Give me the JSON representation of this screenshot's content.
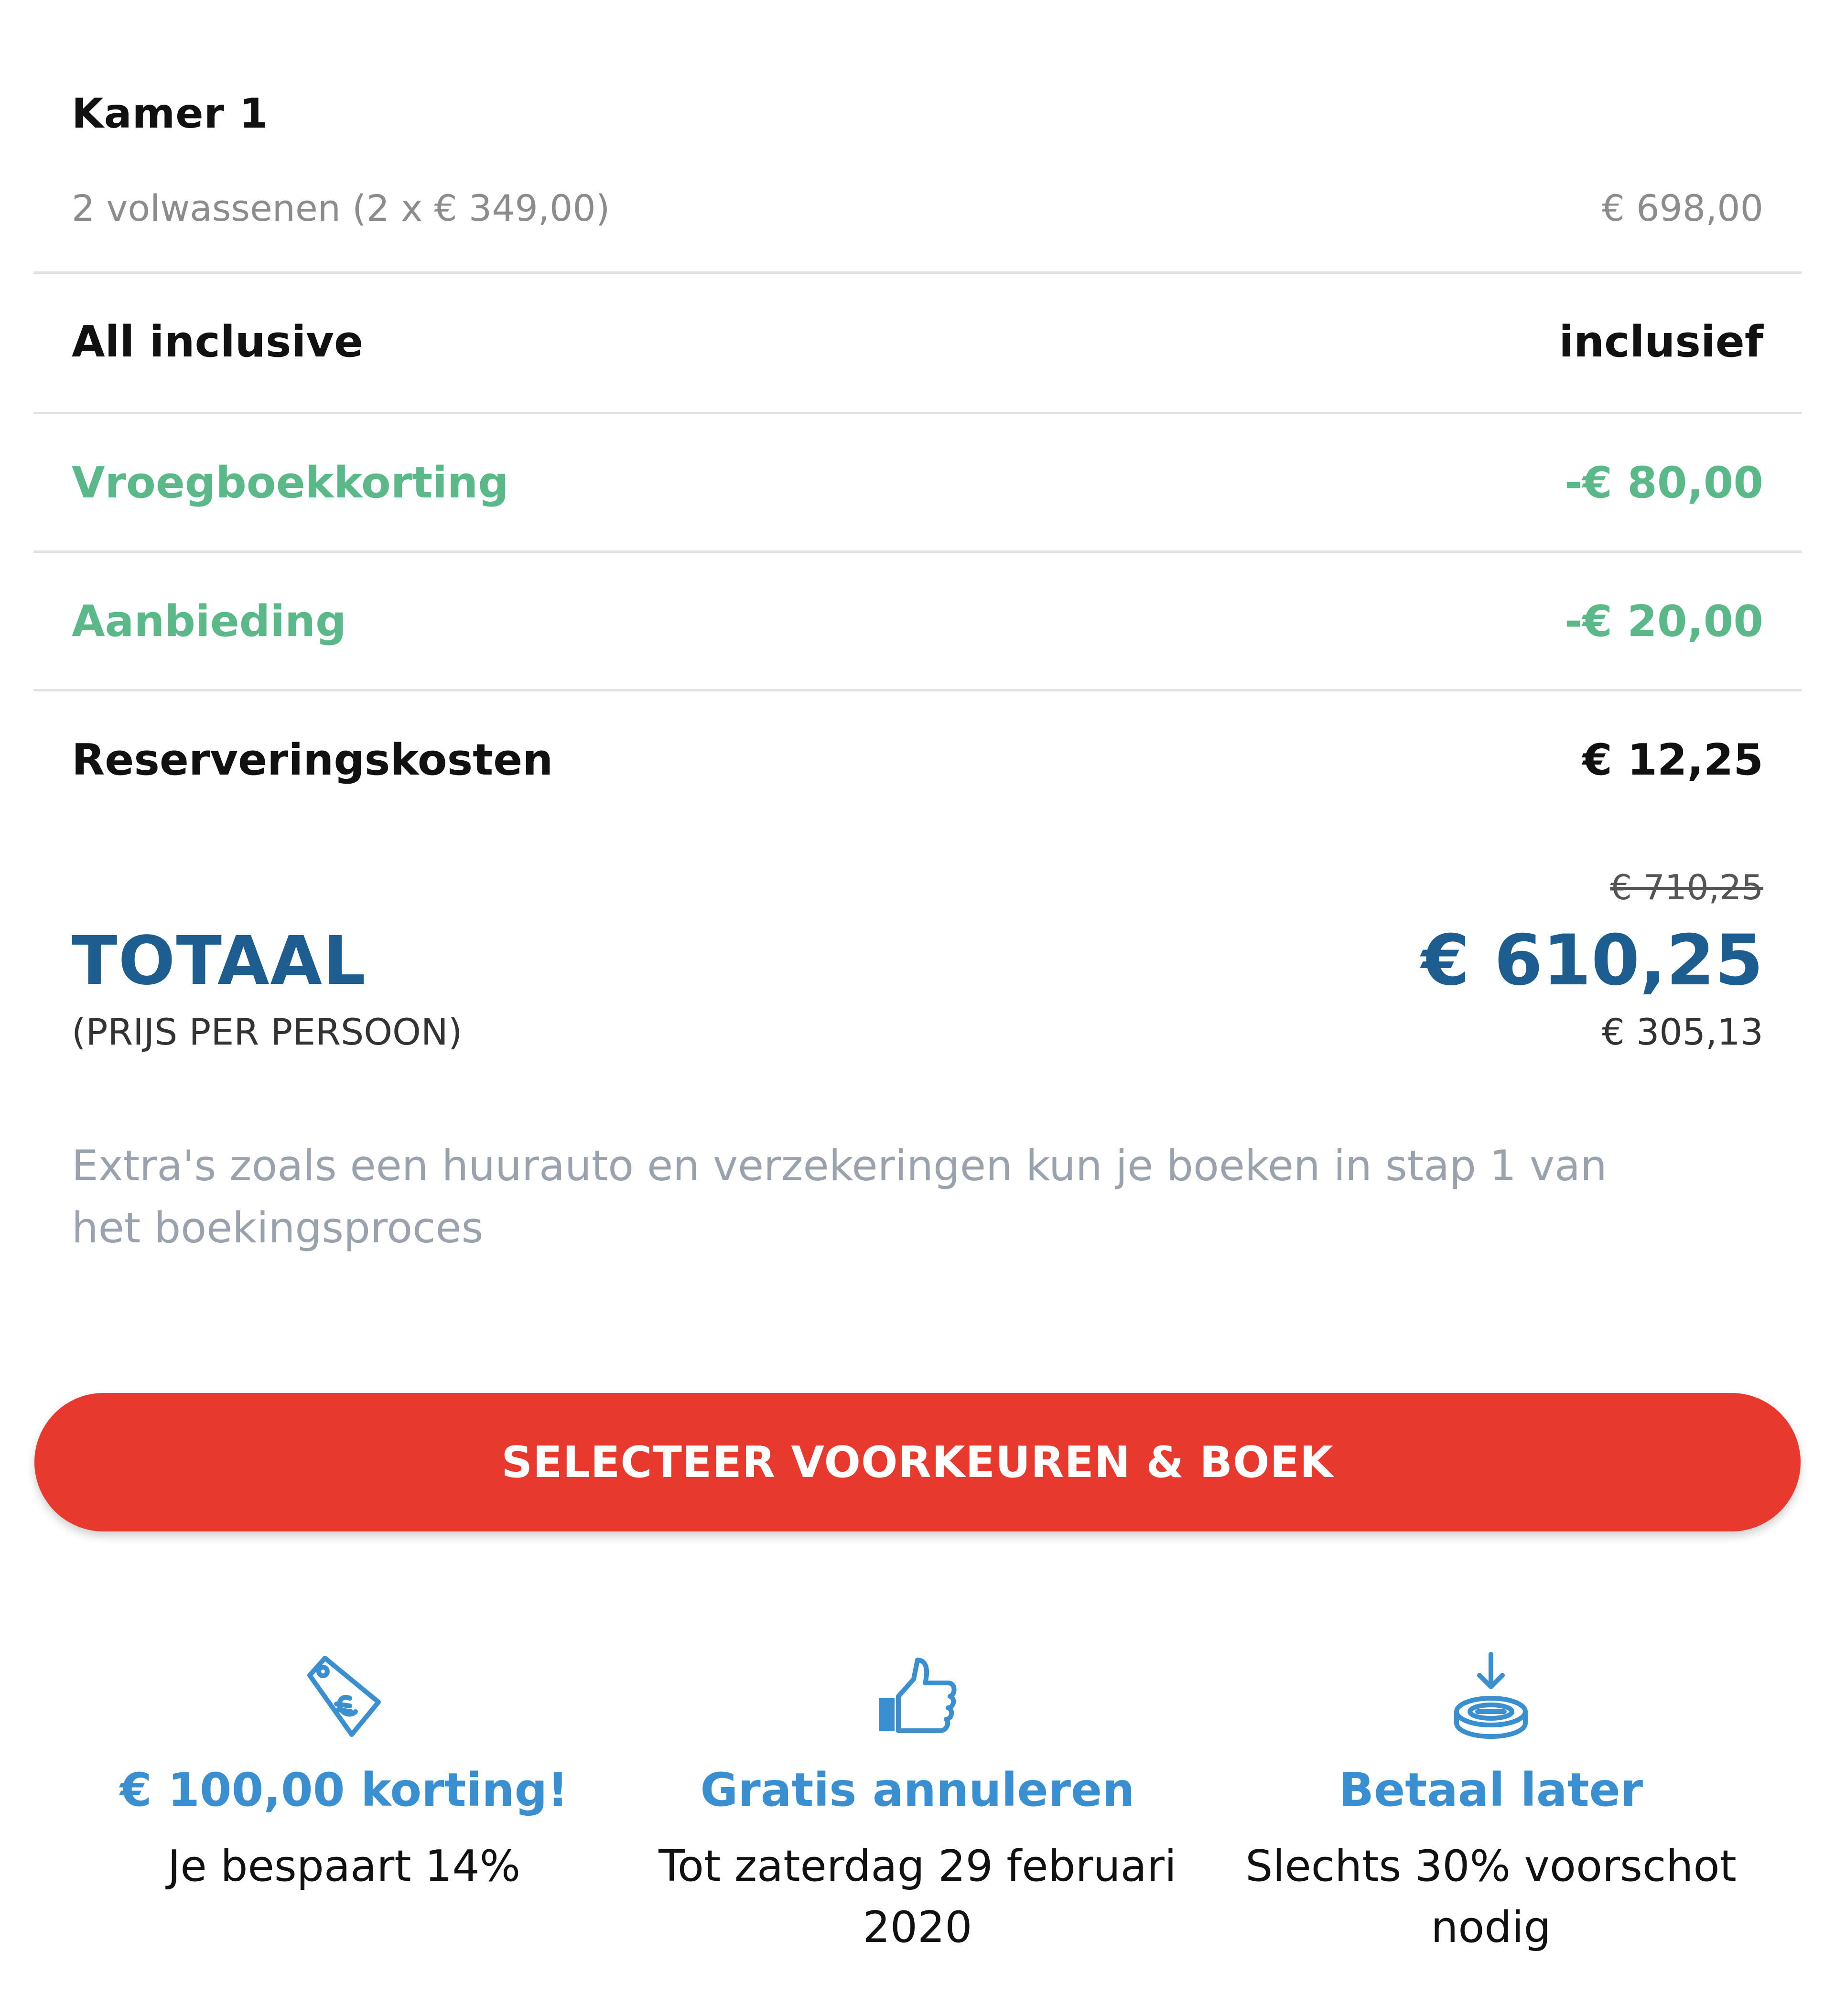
{
  "room": {
    "title": "Kamer 1",
    "guests_label": "2 volwassenen (2 x € 349,00)",
    "guests_price": "€ 698,00"
  },
  "lines": [
    {
      "label": "All inclusive",
      "value": "inclusief",
      "type": "normal"
    },
    {
      "label": "Vroegboekkorting",
      "value": "-€ 80,00",
      "type": "discount"
    },
    {
      "label": "Aanbieding",
      "value": "-€ 20,00",
      "type": "discount"
    },
    {
      "label": "Reserveringskosten",
      "value": "€ 12,25",
      "type": "normal"
    }
  ],
  "total": {
    "old_price": "€ 710,25",
    "label": "TOTAAL",
    "price": "€ 610,25",
    "per_person_label": "(PRIJS PER PERSOON)",
    "per_person_price": "€ 305,13"
  },
  "extras_note": "Extra's zoals een huurauto en verzekeringen kun je boeken in stap 1 van het boekingsproces",
  "cta": {
    "label": "SELECTEER VOORKEUREN & BOEK"
  },
  "usps": [
    {
      "icon": "price-tag-icon",
      "title": "€ 100,00 korting!",
      "text_line1": "Je bespaart 14%",
      "text_line2": ""
    },
    {
      "icon": "thumbs-up-icon",
      "title": "Gratis annuleren",
      "text_line1": "Tot zaterdag 29 februari",
      "text_line2": "2020"
    },
    {
      "icon": "download-coin-icon",
      "title": "Betaal later",
      "text_line1": "Slechts 30% voorschot",
      "text_line2": "nodig"
    }
  ],
  "colors": {
    "discount_green": "#5bb889",
    "total_blue": "#1e5d8f",
    "usp_blue": "#3a8fd0",
    "cta_red": "#e8392f",
    "muted_grey": "#9aa3ad"
  }
}
